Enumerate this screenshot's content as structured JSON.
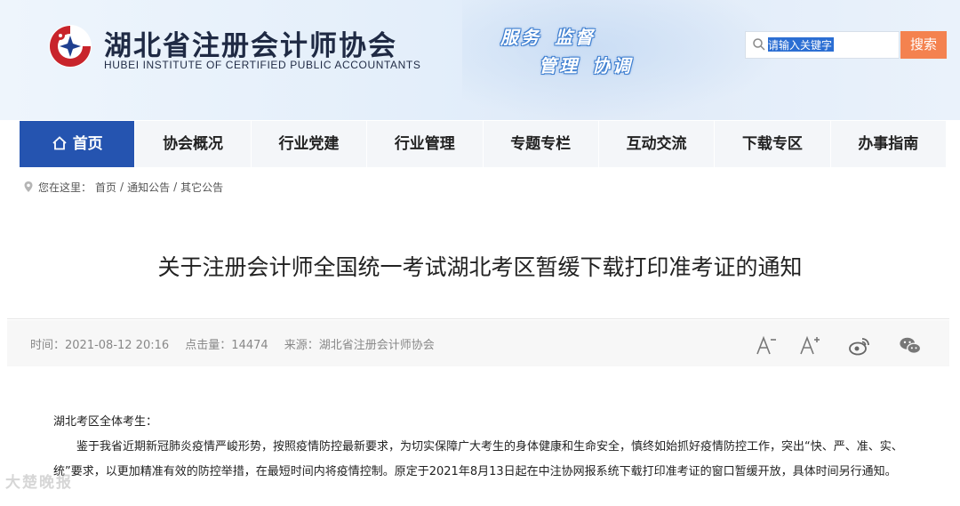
{
  "header": {
    "org_name": "湖北省注册会计师协会",
    "org_name_en": "HUBEI INSTITUTE OF CERTIFIED PUBLIC ACCOUNTANTS",
    "slogans": [
      "服务",
      "监督",
      "管理",
      "协调"
    ]
  },
  "search": {
    "placeholder": "请输入关键字",
    "button_label": "搜索"
  },
  "nav": {
    "items": [
      {
        "label": "首页",
        "active": true
      },
      {
        "label": "协会概况"
      },
      {
        "label": "行业党建"
      },
      {
        "label": "行业管理"
      },
      {
        "label": "专题专栏"
      },
      {
        "label": "互动交流"
      },
      {
        "label": "下载专区"
      },
      {
        "label": "办事指南"
      }
    ]
  },
  "breadcrumb": {
    "prefix": "您在这里：",
    "items": [
      "首页",
      "/",
      "通知公告",
      "/",
      "其它公告"
    ]
  },
  "article": {
    "title": "关于注册会计师全国统一考试湖北考区暂缓下载打印准考证的通知",
    "time": "时间：2021-08-12 20:16",
    "clicks": "点击量：14474",
    "source": "来源：湖北省注册会计师协会",
    "greeting": "湖北考区全体考生：",
    "paragraph": "鉴于我省近期新冠肺炎疫情严峻形势，按照疫情防控最新要求，为切实保障广大考生的身体健康和生命安全，慎终如始抓好疫情防控工作，突出“快、严、准、实、统”要求，以更加精准有效的防控举措，在最短时间内将疫情控制。原定于2021年8月13日起在中注协网报系统下载打印准考证的窗口暂缓开放，具体时间另行通知。"
  },
  "tools": {
    "font_down": "A-",
    "font_up": "A+"
  },
  "watermark": "大楚晚报"
}
